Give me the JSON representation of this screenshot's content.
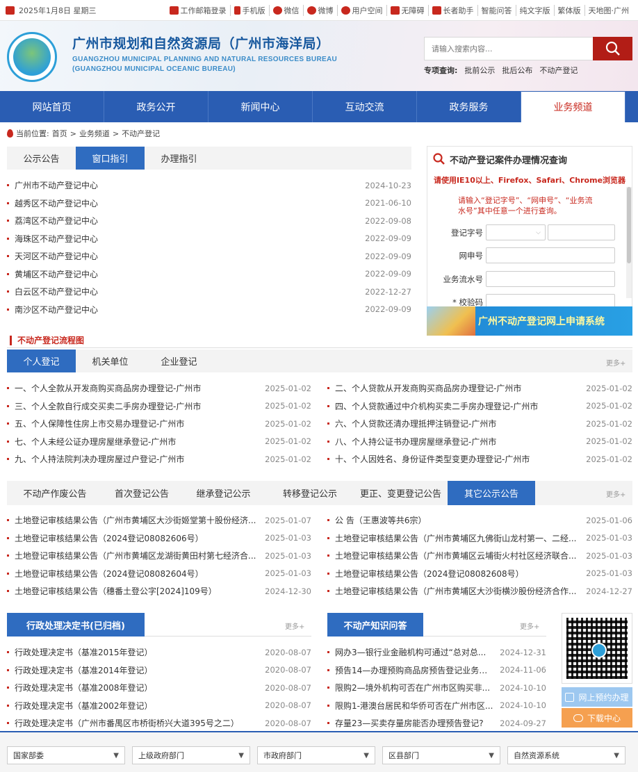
{
  "topbar": {
    "date": "2025年1月8日 星期三",
    "links": [
      "工作邮箱登录",
      "手机版",
      "微信",
      "微博",
      "用户空间",
      "无障碍",
      "长者助手",
      "智能问答",
      "纯文字版",
      "繁体版",
      "天地图·广州"
    ]
  },
  "header": {
    "title_cn": "广州市规划和自然资源局（广州市海洋局）",
    "title_en_1": "GUANGZHOU MUNICIPAL PLANNING AND NATURAL RESOURCES BUREAU",
    "title_en_2": "(GUANGZHOU MUNICIPAL OCEANIC BUREAU)",
    "search_placeholder": "请输入搜索内容...",
    "special_label": "专项查询:",
    "special_links": [
      "批前公示",
      "批后公布",
      "不动产登记"
    ]
  },
  "nav": [
    "网站首页",
    "政务公开",
    "新闻中心",
    "互动交流",
    "政务服务",
    "业务频道"
  ],
  "breadcrumb": {
    "label": "当前位置:",
    "path": [
      "首页",
      ">",
      "业务频道",
      ">",
      "不动产登记"
    ]
  },
  "center_tabs": [
    "公示公告",
    "窗口指引",
    "办理指引"
  ],
  "centers": [
    {
      "t": "广州市不动产登记中心",
      "d": "2024-10-23"
    },
    {
      "t": "越秀区不动产登记中心",
      "d": "2021-06-10"
    },
    {
      "t": "荔湾区不动产登记中心",
      "d": "2022-09-08"
    },
    {
      "t": "海珠区不动产登记中心",
      "d": "2022-09-09"
    },
    {
      "t": "天河区不动产登记中心",
      "d": "2022-09-09"
    },
    {
      "t": "黄埔区不动产登记中心",
      "d": "2022-09-09"
    },
    {
      "t": "白云区不动产登记中心",
      "d": "2022-12-27"
    },
    {
      "t": "南沙区不动产登记中心",
      "d": "2022-09-09"
    }
  ],
  "query": {
    "title": "不动产登记案件办理情况查询",
    "browser_warning": "请使用IE10以上、Firefox、Safari、Chrome浏览器",
    "tip": "请输入“登记字号”、“网申号”、“业务流水号”其中任意一个进行查询。",
    "f1": "登记字号",
    "f2": "网申号",
    "f3": "业务流水号",
    "f4": "* 校验码"
  },
  "banner": "广州不动产登记网上申请系统",
  "flow_title": "不动产登记流程图",
  "flow_tabs": [
    "个人登记",
    "机关单位",
    "企业登记"
  ],
  "more": "更多+",
  "flow_left": [
    {
      "t": "一、个人全款从开发商购买商品房办理登记-广州市",
      "d": "2025-01-02"
    },
    {
      "t": "三、个人全款自行成交买卖二手房办理登记-广州市",
      "d": "2025-01-02"
    },
    {
      "t": "五、个人保障性住房上市交易办理登记-广州市",
      "d": "2025-01-02"
    },
    {
      "t": "七、个人未经公证办理房屋继承登记-广州市",
      "d": "2025-01-02"
    },
    {
      "t": "九、个人持法院判决办理房屋过户登记-广州市",
      "d": "2025-01-02"
    }
  ],
  "flow_right": [
    {
      "t": "二、个人贷款从开发商购买商品房办理登记-广州市",
      "d": "2025-01-02"
    },
    {
      "t": "四、个人贷款通过中介机构买卖二手房办理登记-广州市",
      "d": "2025-01-02"
    },
    {
      "t": "六、个人贷款还清办理抵押注销登记-广州市",
      "d": "2025-01-02"
    },
    {
      "t": "八、个人持公证书办理房屋继承登记-广州市",
      "d": "2025-01-02"
    },
    {
      "t": "十、个人因姓名、身份证件类型变更办理登记-广州市",
      "d": "2025-01-02"
    }
  ],
  "notice_tabs": [
    "不动产作废公告",
    "首次登记公告",
    "继承登记公示",
    "转移登记公示",
    "更正、变更登记公告",
    "其它公示公告"
  ],
  "notice_left": [
    {
      "t": "土地登记审核结果公告（广州市黄埔区大沙街姬堂第十股份经济...",
      "d": "2025-01-07"
    },
    {
      "t": "土地登记审核结果公告（2024登记08082606号）",
      "d": "2025-01-03"
    },
    {
      "t": "土地登记审核结果公告（广州市黄埔区龙湖街黄田村第七经济合...",
      "d": "2025-01-03"
    },
    {
      "t": "土地登记审核结果公告（2024登记08082604号）",
      "d": "2025-01-03"
    },
    {
      "t": "土地登记审核结果公告（穗番土登公字[2024]109号）",
      "d": "2024-12-30"
    }
  ],
  "notice_right": [
    {
      "t": "公 告（王惠波等共6宗）",
      "d": "2025-01-06"
    },
    {
      "t": "土地登记审核结果公告（广州市黄埔区九佛街山龙村第一、二经...",
      "d": "2025-01-03"
    },
    {
      "t": "土地登记审核结果公告（广州市黄埔区云埔街火村社区经济联合...",
      "d": "2025-01-03"
    },
    {
      "t": "土地登记审核结果公告（2024登记08082608号）",
      "d": "2025-01-03"
    },
    {
      "t": "土地登记审核结果公告（广州市黄埔区大沙街横沙股份经济合作...",
      "d": "2024-12-27"
    }
  ],
  "decision_title": "行政处理决定书(已归档)",
  "decisions": [
    {
      "t": "行政处理决定书（基准2015年登记）",
      "d": "2020-08-07"
    },
    {
      "t": "行政处理决定书（基准2014年登记）",
      "d": "2020-08-07"
    },
    {
      "t": "行政处理决定书（基准2008年登记）",
      "d": "2020-08-07"
    },
    {
      "t": "行政处理决定书（基准2002年登记）",
      "d": "2020-08-07"
    },
    {
      "t": "行政处理决定书（广州市番禺区市桥街桥兴大道395号之二）",
      "d": "2020-08-07"
    }
  ],
  "qa_title": "不动产知识问答",
  "qa": [
    {
      "t": "网办3—银行业金融机构可通过“总对总...",
      "d": "2024-12-31"
    },
    {
      "t": "预告14—办理预购商品房预告登记业务，...",
      "d": "2024-11-06"
    },
    {
      "t": "限购2—境外机构可否在广州市区购买非...",
      "d": "2024-10-10"
    },
    {
      "t": "限购1-港澳台居民和华侨可否在广州市区...",
      "d": "2024-10-10"
    },
    {
      "t": "存量23—买卖存量房能否办理预告登记?",
      "d": "2024-09-27"
    }
  ],
  "side_buttons": [
    "网上预约办理",
    "下载中心"
  ],
  "colors": {
    "nav": "#2a5db3",
    "accent": "#c8281e",
    "tab_active": "#2f6cc0"
  },
  "footer_selects": [
    "国家部委",
    "上级政府部门",
    "市政府部门",
    "区县部门",
    "自然资源系统"
  ]
}
